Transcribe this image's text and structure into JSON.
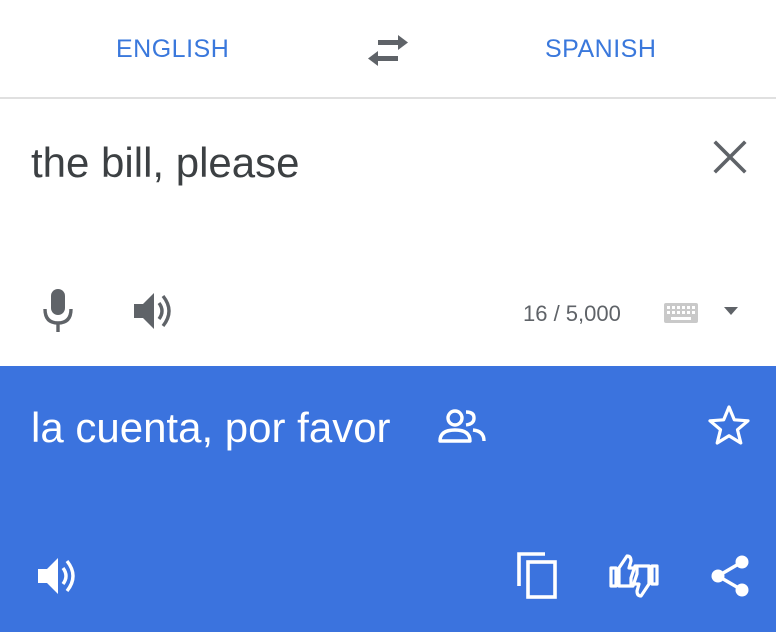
{
  "languages": {
    "source": "ENGLISH",
    "target": "SPANISH",
    "swap_icon": "swap-horiz-icon"
  },
  "input": {
    "text": "the bill, please",
    "char_count": "16 / 5,000",
    "icons": [
      "close-icon",
      "mic-icon",
      "volume-icon",
      "keyboard-icon",
      "dropdown-arrow-icon"
    ]
  },
  "output": {
    "text": "la cuenta, por favor",
    "icons": [
      "people-icon",
      "star-icon",
      "volume-icon",
      "copy-icon",
      "feedback-icon",
      "share-icon"
    ]
  },
  "colors": {
    "accent": "#3a78dc",
    "output_bg": "#3b73de",
    "text_dark": "#3c4043",
    "icon_gray": "#5f6368"
  }
}
